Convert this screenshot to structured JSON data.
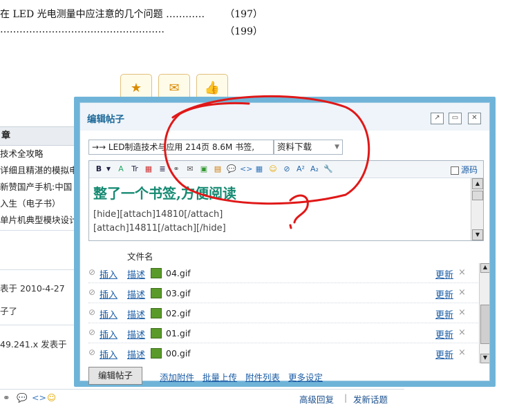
{
  "background": {
    "toc": [
      {
        "text": "在 LED 光电测量中应注意的几个问题 …………",
        "page": "（197）"
      },
      {
        "text": "  ……………………………………………",
        "page": "（199）"
      }
    ],
    "sidebar": {
      "header": "章",
      "items": [
        "技术全攻略",
        "详细且精湛的模拟电",
        "新赞国产手机:中国",
        "入生（电子书）",
        "单片机典型模块设计"
      ]
    },
    "post_meta_1": "表于    2010-4-27",
    "post_meta_2": "子了",
    "post_meta_3": "49.241.x   发表于",
    "bottom_links": {
      "reply": "高级回复",
      "sep": "|",
      "new_topic": "发新话题"
    }
  },
  "modal": {
    "title": "编辑帖子",
    "subject_value": "→→ LED制造技术与应用  214页  8.6M 书签,",
    "type_selected": "资料下载",
    "source_label": "源码",
    "editor": {
      "headline": "整了一个书签,方便阅读",
      "line1": "[hide][attach]14810[/attach]",
      "line2": "[attach]14811[/attach][/hide]"
    },
    "attachments_header": "文件名",
    "attachments": [
      {
        "insert": "插入",
        "describe": "描述",
        "file": "04.gif",
        "update": "更新"
      },
      {
        "insert": "插入",
        "describe": "描述",
        "file": "03.gif",
        "update": "更新"
      },
      {
        "insert": "插入",
        "describe": "描述",
        "file": "02.gif",
        "update": "更新"
      },
      {
        "insert": "插入",
        "describe": "描述",
        "file": "01.gif",
        "update": "更新"
      },
      {
        "insert": "插入",
        "describe": "描述",
        "file": "00.gif",
        "update": "更新"
      }
    ],
    "edit_button": "编辑帖子",
    "links": {
      "add": "添加附件",
      "batch": "批量上传",
      "list": "附件列表",
      "more": "更多设定"
    }
  },
  "colors": {
    "modal_border": "#6fb4d8",
    "link": "#1a5ca5",
    "headline": "#168a72",
    "annotation": "#e01818"
  }
}
